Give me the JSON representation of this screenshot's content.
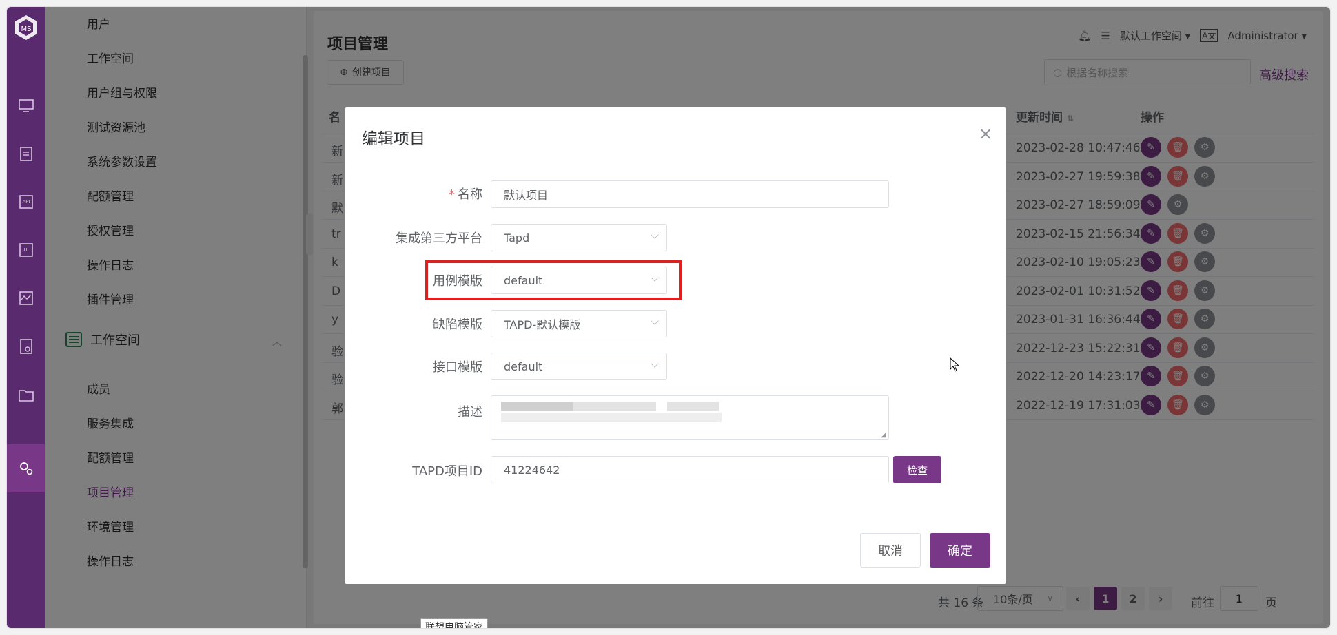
{
  "sidebar": {
    "items_top": [
      "用户",
      "工作空间",
      "用户组与权限",
      "测试资源池",
      "系统参数设置",
      "配额管理",
      "授权管理",
      "操作日志",
      "插件管理"
    ],
    "group_label": "工作空间",
    "items_ws": [
      "成员",
      "服务集成",
      "配额管理",
      "项目管理",
      "环境管理",
      "操作日志"
    ],
    "active_item": "项目管理"
  },
  "rail_icons": [
    "logo-icon",
    "monitor-icon",
    "clipboard-icon",
    "api-icon",
    "ui-icon",
    "performance-icon",
    "report-icon",
    "folder-icon",
    "settings-icon"
  ],
  "header": {
    "page_title": "项目管理",
    "create_label": "创建项目",
    "workspace": "默认工作空间",
    "user": "Administrator",
    "search_placeholder": "根据名称搜索",
    "advanced_search": "高级搜索"
  },
  "table": {
    "col_first_partial": "名",
    "col_updated": "更新时间",
    "col_actions": "操作",
    "rows": [
      {
        "name": "新",
        "updated": "2023-02-28 10:47:46"
      },
      {
        "name": "新",
        "updated": "2023-02-27 19:59:38"
      },
      {
        "name": "默",
        "updated": "2023-02-27 18:59:09"
      },
      {
        "name": "tr",
        "updated": "2023-02-15 21:56:34"
      },
      {
        "name": "k",
        "updated": "2023-02-10 19:05:23"
      },
      {
        "name": "D",
        "updated": "2023-02-01 10:31:52"
      },
      {
        "name": "y",
        "updated": "2023-01-31 16:36:44"
      },
      {
        "name": "验",
        "updated": "2022-12-23 15:22:31"
      },
      {
        "name": "验",
        "updated": "2022-12-20 14:23:17"
      },
      {
        "name": "郭",
        "updated": "2022-12-19 17:31:03"
      }
    ]
  },
  "pagination": {
    "total": "共 16 条",
    "page_size": "10条/页",
    "pages": [
      "1",
      "2"
    ],
    "current": "1",
    "goto_prefix": "前往",
    "goto_value": "1",
    "goto_suffix": "页"
  },
  "dialog": {
    "title": "编辑项目",
    "name_label": "名称",
    "name_value": "默认项目",
    "platform_label": "集成第三方平台",
    "platform_value": "Tapd",
    "case_template_label": "用例模版",
    "case_template_value": "default",
    "issue_template_label": "缺陷模版",
    "issue_template_value": "TAPD-默认模版",
    "api_template_label": "接口模版",
    "api_template_value": "default",
    "desc_label": "描述",
    "tapd_label": "TAPD项目ID",
    "tapd_value": "41224642",
    "check_label": "检查",
    "cancel_label": "取消",
    "confirm_label": "确定"
  },
  "tooltip": "联想电脑管家",
  "colors": {
    "brand": "#783887",
    "rail": "#5a2a6f",
    "danger": "#f56c6c",
    "highlight": "#e02020"
  }
}
